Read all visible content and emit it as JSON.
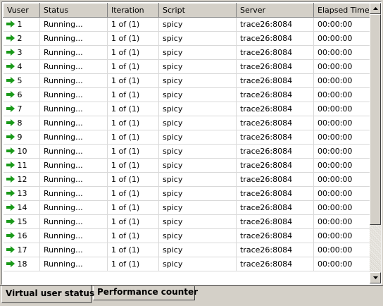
{
  "grid": {
    "columns": [
      "Vuser",
      "Status",
      "Iteration",
      "Script",
      "Server",
      "Elapsed Time"
    ],
    "rows": [
      {
        "vuser": "1",
        "status": "Running...",
        "iteration": "1 of (1)",
        "script": "spicy",
        "server": "trace26:8084",
        "elapsed": "00:00:00"
      },
      {
        "vuser": "2",
        "status": "Running...",
        "iteration": "1 of (1)",
        "script": "spicy",
        "server": "trace26:8084",
        "elapsed": "00:00:00"
      },
      {
        "vuser": "3",
        "status": "Running...",
        "iteration": "1 of (1)",
        "script": "spicy",
        "server": "trace26:8084",
        "elapsed": "00:00:00"
      },
      {
        "vuser": "4",
        "status": "Running...",
        "iteration": "1 of (1)",
        "script": "spicy",
        "server": "trace26:8084",
        "elapsed": "00:00:00"
      },
      {
        "vuser": "5",
        "status": "Running...",
        "iteration": "1 of (1)",
        "script": "spicy",
        "server": "trace26:8084",
        "elapsed": "00:00:00"
      },
      {
        "vuser": "6",
        "status": "Running...",
        "iteration": "1 of (1)",
        "script": "spicy",
        "server": "trace26:8084",
        "elapsed": "00:00:00"
      },
      {
        "vuser": "7",
        "status": "Running...",
        "iteration": "1 of (1)",
        "script": "spicy",
        "server": "trace26:8084",
        "elapsed": "00:00:00"
      },
      {
        "vuser": "8",
        "status": "Running...",
        "iteration": "1 of (1)",
        "script": "spicy",
        "server": "trace26:8084",
        "elapsed": "00:00:00"
      },
      {
        "vuser": "9",
        "status": "Running...",
        "iteration": "1 of (1)",
        "script": "spicy",
        "server": "trace26:8084",
        "elapsed": "00:00:00"
      },
      {
        "vuser": "10",
        "status": "Running...",
        "iteration": "1 of (1)",
        "script": "spicy",
        "server": "trace26:8084",
        "elapsed": "00:00:00"
      },
      {
        "vuser": "11",
        "status": "Running...",
        "iteration": "1 of (1)",
        "script": "spicy",
        "server": "trace26:8084",
        "elapsed": "00:00:00"
      },
      {
        "vuser": "12",
        "status": "Running...",
        "iteration": "1 of (1)",
        "script": "spicy",
        "server": "trace26:8084",
        "elapsed": "00:00:00"
      },
      {
        "vuser": "13",
        "status": "Running...",
        "iteration": "1 of (1)",
        "script": "spicy",
        "server": "trace26:8084",
        "elapsed": "00:00:00"
      },
      {
        "vuser": "14",
        "status": "Running...",
        "iteration": "1 of (1)",
        "script": "spicy",
        "server": "trace26:8084",
        "elapsed": "00:00:00"
      },
      {
        "vuser": "15",
        "status": "Running...",
        "iteration": "1 of (1)",
        "script": "spicy",
        "server": "trace26:8084",
        "elapsed": "00:00:00"
      },
      {
        "vuser": "16",
        "status": "Running...",
        "iteration": "1 of (1)",
        "script": "spicy",
        "server": "trace26:8084",
        "elapsed": "00:00:00"
      },
      {
        "vuser": "17",
        "status": "Running...",
        "iteration": "1 of (1)",
        "script": "spicy",
        "server": "trace26:8084",
        "elapsed": "00:00:00"
      },
      {
        "vuser": "18",
        "status": "Running...",
        "iteration": "1 of (1)",
        "script": "spicy",
        "server": "trace26:8084",
        "elapsed": "00:00:00"
      }
    ],
    "row_icon": "green-arrow-right-icon",
    "icon_color": "#1a9a1a"
  },
  "tabs": {
    "active_label": "Virtual user status",
    "inactive_label": "Performance counter"
  }
}
